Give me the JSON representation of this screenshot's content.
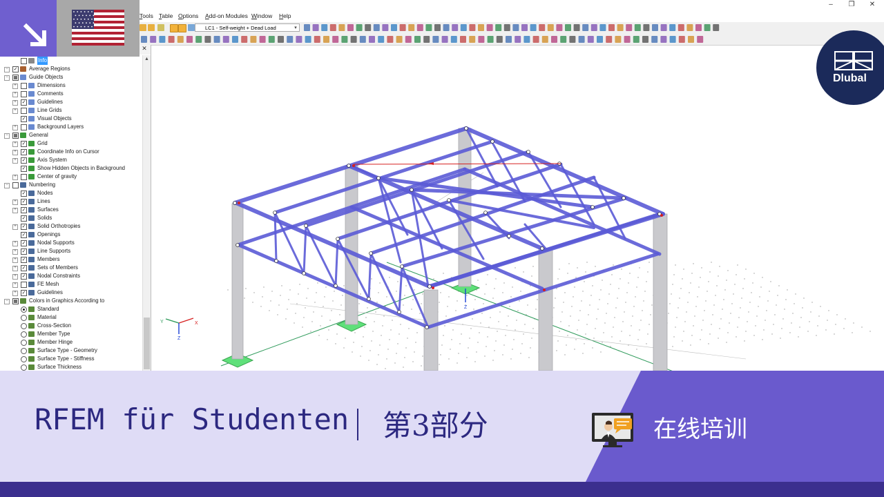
{
  "window_controls": {
    "minimize": "–",
    "restore": "❐",
    "close": "✕"
  },
  "menu": {
    "items": [
      "Tools",
      "Table",
      "Options",
      "Add-on Modules",
      "Window",
      "Help"
    ]
  },
  "toolbar": {
    "load_case_label": "LC1 - Self-weight + Dead Load"
  },
  "navigator": {
    "close_label": "✕",
    "items": [
      {
        "label": "Info",
        "selected": true,
        "checked": "off"
      },
      {
        "label": "Average Regions",
        "checked": "on"
      },
      {
        "label": "Guide Objects",
        "checked": "partial"
      },
      {
        "label": "Dimensions",
        "checked": "off"
      },
      {
        "label": "Comments",
        "checked": "off"
      },
      {
        "label": "Guidelines",
        "checked": "on"
      },
      {
        "label": "Line Grids",
        "checked": "off"
      },
      {
        "label": "Visual Objects",
        "checked": "on"
      },
      {
        "label": "Background Layers",
        "checked": "off"
      },
      {
        "label": "General",
        "checked": "partial"
      },
      {
        "label": "Grid",
        "checked": "on"
      },
      {
        "label": "Coordinate Info on Cursor",
        "checked": "on"
      },
      {
        "label": "Axis System",
        "checked": "on"
      },
      {
        "label": "Show Hidden Objects in Background",
        "checked": "on"
      },
      {
        "label": "Center of gravity",
        "checked": "off"
      },
      {
        "label": "Numbering",
        "checked": "off"
      },
      {
        "label": "Nodes",
        "checked": "on"
      },
      {
        "label": "Lines",
        "checked": "on"
      },
      {
        "label": "Surfaces",
        "checked": "on"
      },
      {
        "label": "Solids",
        "checked": "on"
      },
      {
        "label": "Solid Orthotropies",
        "checked": "on"
      },
      {
        "label": "Openings",
        "checked": "on"
      },
      {
        "label": "Nodal Supports",
        "checked": "on"
      },
      {
        "label": "Line Supports",
        "checked": "on"
      },
      {
        "label": "Members",
        "checked": "on"
      },
      {
        "label": "Sets of Members",
        "checked": "on"
      },
      {
        "label": "Nodal Constraints",
        "checked": "on"
      },
      {
        "label": "FE Mesh",
        "checked": "off"
      },
      {
        "label": "Guidelines",
        "checked": "on"
      },
      {
        "label": "Colors in Graphics According to",
        "checked": "partial"
      },
      {
        "label": "Standard",
        "checked": "radio-on"
      },
      {
        "label": "Material",
        "checked": "radio"
      },
      {
        "label": "Cross-Section",
        "checked": "radio"
      },
      {
        "label": "Member Type",
        "checked": "radio"
      },
      {
        "label": "Member Hinge",
        "checked": "radio"
      },
      {
        "label": "Surface Type - Geometry",
        "checked": "radio"
      },
      {
        "label": "Surface Type - Stiffness",
        "checked": "radio"
      },
      {
        "label": "Surface Thickness",
        "checked": "radio"
      }
    ]
  },
  "viewport": {
    "axes": {
      "x": "X",
      "y": "Y",
      "z": "Z"
    },
    "colors": {
      "member": "#5b5bd6",
      "column": "#c8c8cc",
      "support": "#4cd964",
      "load": "#d62020"
    }
  },
  "brand": {
    "name": "Dlubal"
  },
  "banner": {
    "title": "RFEM für Studenten",
    "part": "第3部分",
    "online_label": "在线培训"
  },
  "colors": {
    "banner_bg": "#dfdcf6",
    "banner_accent": "#6a5acd",
    "footer": "#3b2f8e",
    "title_text": "#2c2880",
    "logo_bg": "#1b2a5a"
  }
}
